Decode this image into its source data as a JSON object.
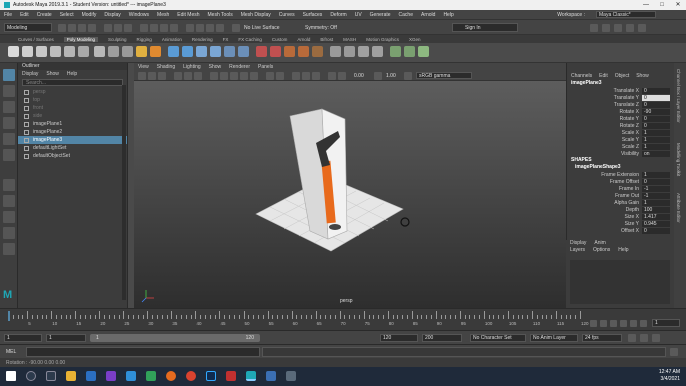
{
  "window": {
    "title": "Autodesk Maya 2019.3.1 - Student Version: untitled*   ---   imagePlane3"
  },
  "menubar": {
    "items": [
      "File",
      "Edit",
      "Create",
      "Select",
      "Modify",
      "Display",
      "Windows",
      "Mesh",
      "Edit Mesh",
      "Mesh Tools",
      "Mesh Display",
      "Curves",
      "Surfaces",
      "Deform",
      "UV",
      "Generate",
      "Cache",
      "Arnold",
      "Help"
    ]
  },
  "workspace": {
    "label": "Workspace :",
    "value": "Maya Classic*"
  },
  "statusline": {
    "mode": "Modeling",
    "live_surface": "No Live Surface",
    "symmetry": "Symmetry: Off",
    "signin": "Sign In"
  },
  "shelf_tabs": [
    "Curves / Surfaces",
    "Poly Modeling",
    "Sculpting",
    "Rigging",
    "Animation",
    "Rendering",
    "FX",
    "FX Caching",
    "Custom",
    "Arnold",
    "Bifrost",
    "MASH",
    "Motion Graphics",
    "XGen"
  ],
  "shelf_active": "Poly Modeling",
  "outliner": {
    "title": "Outliner",
    "menu": [
      "Display",
      "Show",
      "Help"
    ],
    "search_placeholder": "Search...",
    "items": [
      {
        "label": "persp",
        "state": "dim"
      },
      {
        "label": "top",
        "state": "dim"
      },
      {
        "label": "front",
        "state": "dim"
      },
      {
        "label": "side",
        "state": "dim"
      },
      {
        "label": "imagePlane1",
        "state": "normal"
      },
      {
        "label": "imagePlane2",
        "state": "normal"
      },
      {
        "label": "imagePlane3",
        "state": "selected"
      },
      {
        "label": "defaultLightSet",
        "state": "normal"
      },
      {
        "label": "defaultObjectSet",
        "state": "normal"
      }
    ]
  },
  "viewport": {
    "menu": [
      "View",
      "Shading",
      "Lighting",
      "Show",
      "Renderer",
      "Panels"
    ],
    "exposure": "0.00",
    "gamma": "1.00",
    "colorspace": "sRGB gamma",
    "camera_label": "persp"
  },
  "channelbox": {
    "menu": [
      "Channels",
      "Edit",
      "Object",
      "Show"
    ],
    "object": "imagePlane3",
    "attributes": [
      {
        "label": "Translate X",
        "value": "0",
        "hl": false
      },
      {
        "label": "Translate Y",
        "value": "0",
        "hl": true
      },
      {
        "label": "Translate Z",
        "value": "0",
        "hl": false
      },
      {
        "label": "Rotate X",
        "value": "-90",
        "hl": false
      },
      {
        "label": "Rotate Y",
        "value": "0",
        "hl": false
      },
      {
        "label": "Rotate Z",
        "value": "0",
        "hl": false
      },
      {
        "label": "Scale X",
        "value": "1",
        "hl": false
      },
      {
        "label": "Scale Y",
        "value": "1",
        "hl": false
      },
      {
        "label": "Scale Z",
        "value": "1",
        "hl": false
      },
      {
        "label": "Visibility",
        "value": "on",
        "hl": false
      }
    ],
    "shapes_header": "SHAPES",
    "shape_name": "imagePlaneShape3",
    "shape_attributes": [
      {
        "label": "Frame Extension",
        "value": "1"
      },
      {
        "label": "Frame Offset",
        "value": "0"
      },
      {
        "label": "Frame In",
        "value": "-1"
      },
      {
        "label": "Frame Out",
        "value": "-1"
      },
      {
        "label": "Alpha Gain",
        "value": "1"
      },
      {
        "label": "Depth",
        "value": "100"
      },
      {
        "label": "Size X",
        "value": "1.417"
      },
      {
        "label": "Size Y",
        "value": "0.945"
      },
      {
        "label": "Offset X",
        "value": "0"
      }
    ]
  },
  "display": {
    "tabs": [
      "Display",
      "Anim"
    ],
    "menu": [
      "Layers",
      "Options",
      "Help"
    ]
  },
  "sidetabs": [
    "Channel Box / Layer Editor",
    "Modelling Toolkit",
    "Attribute Editor"
  ],
  "timeline": {
    "ticks": [
      "5",
      "10",
      "15",
      "20",
      "25",
      "30",
      "35",
      "40",
      "45",
      "50",
      "55",
      "60",
      "65",
      "70",
      "75",
      "80",
      "85",
      "90",
      "95",
      "100",
      "105",
      "110",
      "115",
      "120"
    ],
    "current": "1"
  },
  "rangebar": {
    "start": "1",
    "start2": "1",
    "range_start": "1",
    "range_end": "120",
    "end": "120",
    "end2": "200",
    "character": "No Character Set",
    "anim_layer": "No Anim Layer",
    "fps": "24 fps"
  },
  "mel": {
    "label": "MEL"
  },
  "help": {
    "text": "Rotation :   -90.00   0.00   0.00"
  },
  "taskbar": {
    "time": "12:47 AM",
    "date": "3/4/2021"
  },
  "colors": {
    "accent": "#5285a6",
    "maya_teal": "#1fa7b5",
    "highlight_attr": "#dddddd"
  }
}
